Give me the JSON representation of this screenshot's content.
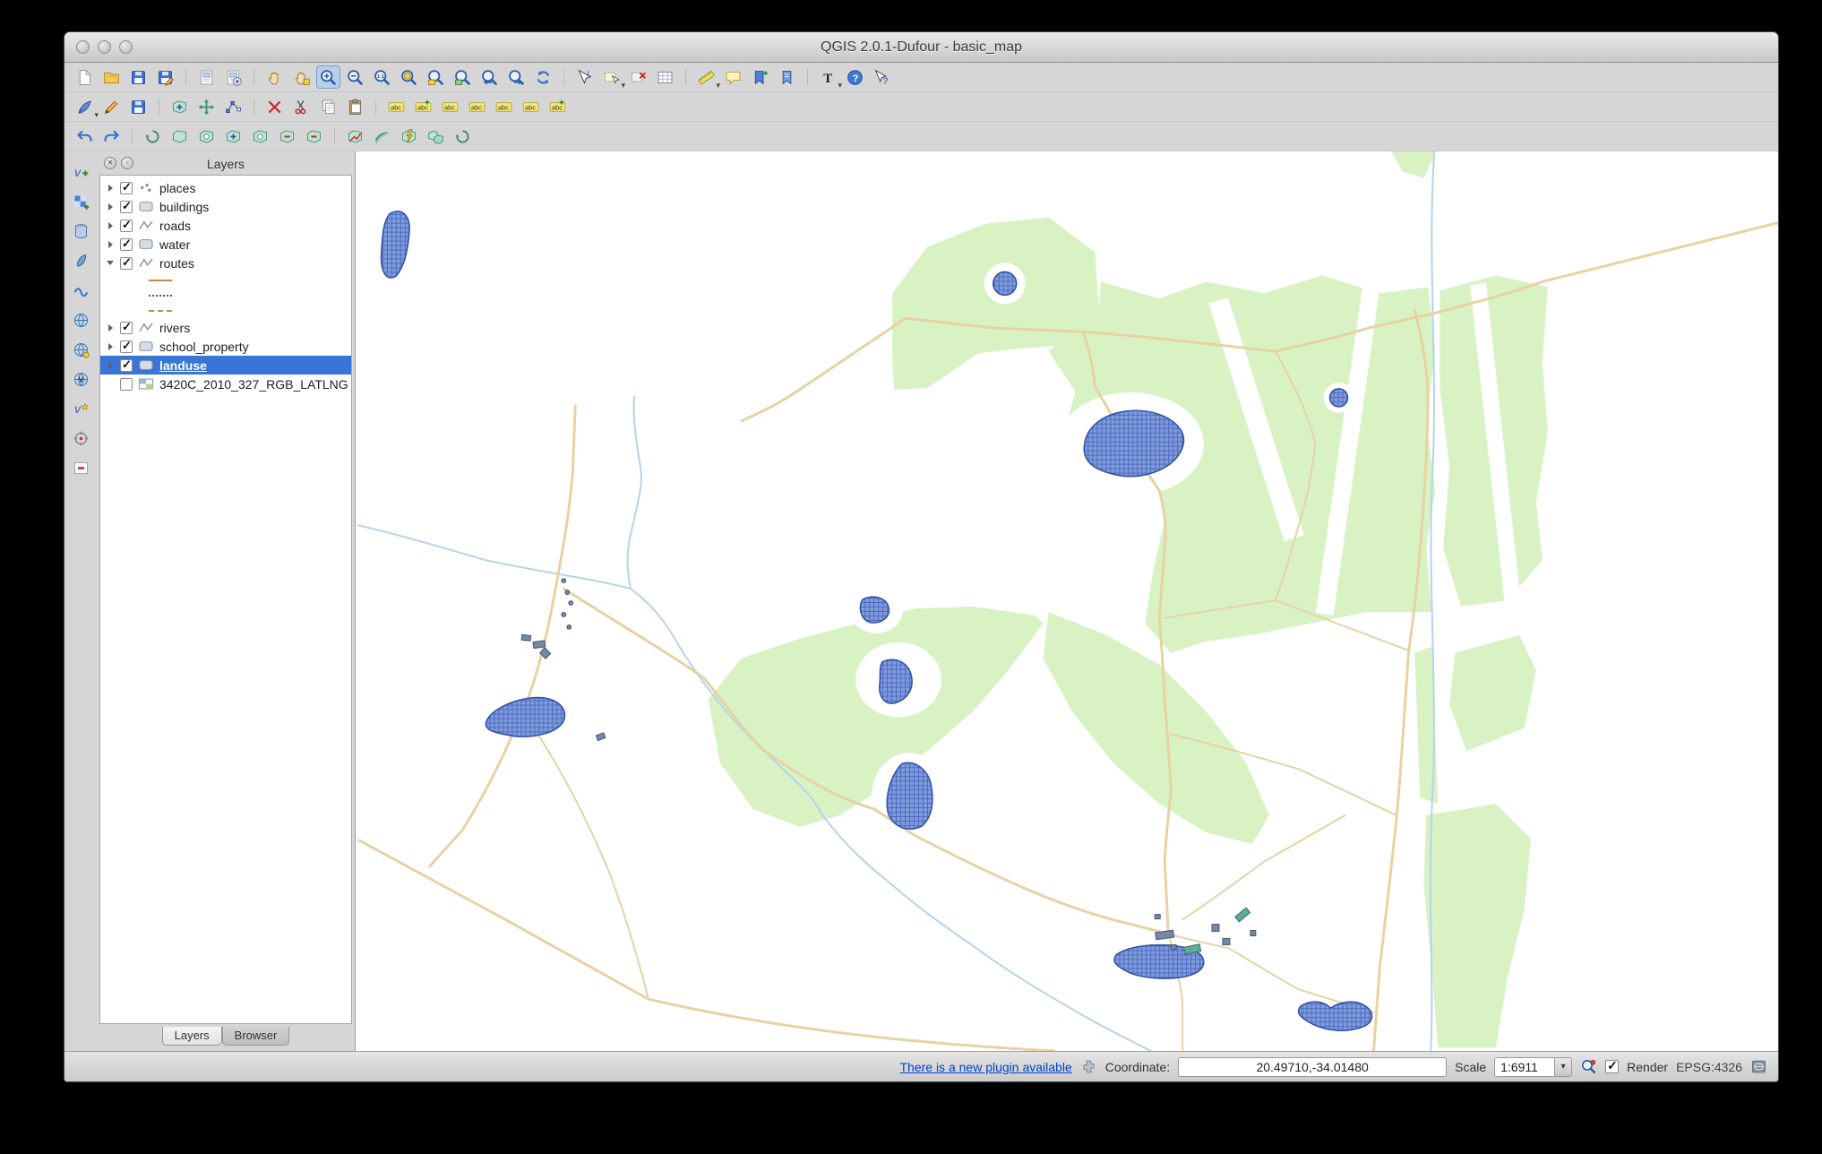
{
  "window": {
    "title": "QGIS 2.0.1-Dufour - basic_map"
  },
  "layers_panel": {
    "title": "Layers",
    "tabs": [
      "Layers",
      "Browser"
    ],
    "items": [
      {
        "kind": "layer",
        "name": "layer-places",
        "label": "places",
        "checked": true,
        "icon": "point",
        "expander": "collapsed"
      },
      {
        "kind": "layer",
        "name": "layer-buildings",
        "label": "buildings",
        "checked": true,
        "icon": "polygon",
        "expander": "collapsed"
      },
      {
        "kind": "layer",
        "name": "layer-roads",
        "label": "roads",
        "checked": true,
        "icon": "line",
        "expander": "collapsed"
      },
      {
        "kind": "layer",
        "name": "layer-water",
        "label": "water",
        "checked": true,
        "icon": "polygon",
        "expander": "collapsed"
      },
      {
        "kind": "layer",
        "name": "layer-routes",
        "label": "routes",
        "checked": true,
        "icon": "line",
        "expander": "expanded"
      },
      {
        "kind": "legend",
        "name": "routes-symbol-1",
        "symbol": "solid"
      },
      {
        "kind": "legend",
        "name": "routes-symbol-2",
        "symbol": "dotted"
      },
      {
        "kind": "legend",
        "name": "routes-symbol-3",
        "symbol": "dashed"
      },
      {
        "kind": "layer",
        "name": "layer-rivers",
        "label": "rivers",
        "checked": true,
        "icon": "line",
        "expander": "collapsed"
      },
      {
        "kind": "layer",
        "name": "layer-school-property",
        "label": "school_property",
        "checked": true,
        "icon": "polygon",
        "expander": "collapsed"
      },
      {
        "kind": "layer",
        "name": "layer-landuse",
        "label": "landuse",
        "checked": true,
        "icon": "polygon",
        "expander": "collapsed",
        "selected": true
      },
      {
        "kind": "layer",
        "name": "layer-3420C-raster",
        "label": "3420C_2010_327_RGB_LATLNG",
        "checked": false,
        "icon": "raster",
        "expander": "none"
      }
    ]
  },
  "toolbar_main": [
    {
      "name": "new-project-button",
      "sym": "#s-page"
    },
    {
      "name": "open-project-button",
      "sym": "#s-folder"
    },
    {
      "name": "save-project-button",
      "sym": "#s-floppy"
    },
    {
      "name": "save-project-as-button",
      "sym": "#s-floppy-pen"
    },
    {
      "kind": "sep"
    },
    {
      "name": "new-composer-button",
      "sym": "#s-composer"
    },
    {
      "name": "composer-manager-button",
      "sym": "#s-composer-mgr"
    },
    {
      "kind": "sep"
    },
    {
      "name": "pan-map-button",
      "sym": "#s-hand"
    },
    {
      "name": "pan-to-selection-button",
      "sym": "#s-hand-sel"
    },
    {
      "name": "zoom-in-button",
      "sym": "#s-zoom-in",
      "active": true
    },
    {
      "name": "zoom-out-button",
      "sym": "#s-zoom-out"
    },
    {
      "name": "zoom-actual-button",
      "sym": "#s-zoom-actual"
    },
    {
      "name": "zoom-full-button",
      "sym": "#s-zoom-full"
    },
    {
      "name": "zoom-to-layer-button",
      "sym": "#s-zoom-layer"
    },
    {
      "name": "zoom-to-selection-button",
      "sym": "#s-zoom-select"
    },
    {
      "name": "zoom-last-button",
      "sym": "#s-zoom-last"
    },
    {
      "name": "zoom-next-button",
      "sym": "#s-zoom-next"
    },
    {
      "name": "refresh-map-button",
      "sym": "#s-refresh"
    },
    {
      "kind": "sep"
    },
    {
      "name": "identify-button",
      "sym": "#s-identify"
    },
    {
      "name": "select-features-button",
      "sym": "#s-select",
      "dd": true
    },
    {
      "name": "deselect-features-button",
      "sym": "#s-deselect"
    },
    {
      "name": "open-attribute-table-button",
      "sym": "#s-table"
    },
    {
      "kind": "sep"
    },
    {
      "name": "measure-button",
      "sym": "#s-measure",
      "dd": true
    },
    {
      "name": "map-tips-button",
      "sym": "#s-tips"
    },
    {
      "name": "new-bookmark-button",
      "sym": "#s-bm-new"
    },
    {
      "name": "show-bookmarks-button",
      "sym": "#s-bm-show"
    },
    {
      "kind": "sep"
    },
    {
      "name": "text-annotation-button",
      "sym": "#s-text",
      "dd": true
    },
    {
      "name": "help-button",
      "sym": "#s-help"
    },
    {
      "name": "whats-this-button",
      "sym": "#s-whats"
    }
  ],
  "toolbar_digitizing": [
    {
      "name": "current-edits-button",
      "sym": "#s-pen",
      "dd": true
    },
    {
      "name": "toggle-editing-button",
      "sym": "#s-pencil"
    },
    {
      "name": "save-layer-edits-button",
      "sym": "#s-floppy"
    },
    {
      "kind": "sep"
    },
    {
      "name": "add-feature-button",
      "sym": "#s-teal-plus"
    },
    {
      "name": "move-feature-button",
      "sym": "#s-move"
    },
    {
      "name": "node-tool-button",
      "sym": "#s-node"
    },
    {
      "kind": "sep"
    },
    {
      "name": "delete-selected-button",
      "sym": "#s-del"
    },
    {
      "name": "cut-features-button",
      "sym": "#s-cut"
    },
    {
      "name": "copy-features-button",
      "sym": "#s-copy"
    },
    {
      "name": "paste-features-button",
      "sym": "#s-paste"
    },
    {
      "kind": "sep"
    },
    {
      "name": "labeling-button",
      "sym": "#s-abc"
    },
    {
      "name": "label-add-button",
      "sym": "#s-abc-plus"
    },
    {
      "name": "label-move-button",
      "sym": "#s-abc"
    },
    {
      "name": "label-rotate-button",
      "sym": "#s-abc"
    },
    {
      "name": "label-pin-button",
      "sym": "#s-abc"
    },
    {
      "name": "label-show-hide-button",
      "sym": "#s-abc"
    },
    {
      "name": "label-properties-button",
      "sym": "#s-abc-plus"
    }
  ],
  "toolbar_advanced": [
    {
      "name": "undo-button",
      "sym": "#s-undo"
    },
    {
      "name": "redo-button",
      "sym": "#s-redo"
    },
    {
      "kind": "sep"
    },
    {
      "name": "rotate-feature-button",
      "sym": "#s-rotpt"
    },
    {
      "name": "simplify-feature-button",
      "sym": "#s-teal"
    },
    {
      "name": "add-ring-button",
      "sym": "#s-teal-ring"
    },
    {
      "name": "add-part-button",
      "sym": "#s-teal-plus"
    },
    {
      "name": "fill-ring-button",
      "sym": "#s-teal-ring"
    },
    {
      "name": "delete-ring-button",
      "sym": "#s-teal-minus"
    },
    {
      "name": "delete-part-button",
      "sym": "#s-teal-minus"
    },
    {
      "kind": "sep"
    },
    {
      "name": "reshape-features-button",
      "sym": "#s-reshape"
    },
    {
      "name": "offset-curve-button",
      "sym": "#s-offset"
    },
    {
      "name": "split-features-button",
      "sym": "#s-split"
    },
    {
      "name": "merge-features-button",
      "sym": "#s-merge"
    },
    {
      "name": "rotate-point-symbols-button",
      "sym": "#s-rotpt"
    }
  ],
  "toolbar_side": [
    {
      "name": "add-vector-layer-button",
      "sym": "#s-vlayer"
    },
    {
      "name": "add-raster-layer-button",
      "sym": "#s-rlayer"
    },
    {
      "name": "add-postgis-layer-button",
      "sym": "#s-db"
    },
    {
      "name": "add-spatialite-layer-button",
      "sym": "#s-quill"
    },
    {
      "name": "add-mssql-layer-button",
      "sym": "#s-wave"
    },
    {
      "name": "add-wms-layer-button",
      "sym": "#s-globe"
    },
    {
      "name": "add-wcs-layer-button",
      "sym": "#s-globe2"
    },
    {
      "name": "add-wfs-layer-button",
      "sym": "#s-vglobe"
    },
    {
      "name": "new-shapefile-button",
      "sym": "#s-vstar"
    },
    {
      "name": "coordinate-capture-button",
      "sym": "#s-coordcap"
    },
    {
      "name": "remove-layer-button",
      "sym": "#s-remove"
    }
  ],
  "status_bar": {
    "plugin_link": "There is a new plugin available",
    "coordinate_label": "Coordinate:",
    "coordinate_value": "20.49710,-34.01480",
    "scale_label": "Scale",
    "scale_value": "1:6911",
    "render_label": "Render",
    "crs_label": "EPSG:4326"
  },
  "colors": {
    "selection_blue": "#3875d7",
    "landuse_green": "#d8f2c4",
    "water_blue": "#7f9bdc",
    "water_hatch": "#4e6cc0",
    "water_outline": "#3353a8",
    "road_tan": "#e7d2a4",
    "river_blue": "#b5d2ef",
    "link_blue": "#0044cc"
  }
}
